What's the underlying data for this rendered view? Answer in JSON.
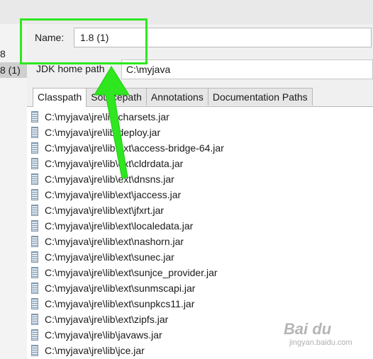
{
  "left": {
    "item1": "8",
    "item2": "8 (1)"
  },
  "form": {
    "name_label": "Name:",
    "name_value": "1.8 (1)",
    "jdk_label": "JDK home path",
    "jdk_value": "C:\\myjava"
  },
  "tabs": [
    {
      "label": "Classpath",
      "active": true
    },
    {
      "label": "Sourcepath"
    },
    {
      "label": "Annotations"
    },
    {
      "label": "Documentation Paths"
    }
  ],
  "classpath": [
    "C:\\myjava\\jre\\lib\\charsets.jar",
    "C:\\myjava\\jre\\lib\\deploy.jar",
    "C:\\myjava\\jre\\lib\\ext\\access-bridge-64.jar",
    "C:\\myjava\\jre\\lib\\ext\\cldrdata.jar",
    "C:\\myjava\\jre\\lib\\ext\\dnsns.jar",
    "C:\\myjava\\jre\\lib\\ext\\jaccess.jar",
    "C:\\myjava\\jre\\lib\\ext\\jfxrt.jar",
    "C:\\myjava\\jre\\lib\\ext\\localedata.jar",
    "C:\\myjava\\jre\\lib\\ext\\nashorn.jar",
    "C:\\myjava\\jre\\lib\\ext\\sunec.jar",
    "C:\\myjava\\jre\\lib\\ext\\sunjce_provider.jar",
    "C:\\myjava\\jre\\lib\\ext\\sunmscapi.jar",
    "C:\\myjava\\jre\\lib\\ext\\sunpkcs11.jar",
    "C:\\myjava\\jre\\lib\\ext\\zipfs.jar",
    "C:\\myjava\\jre\\lib\\javaws.jar",
    "C:\\myjava\\jre\\lib\\jce.jar"
  ],
  "watermark": {
    "main": "Bai du",
    "sub": "jingyan.baidu.com"
  },
  "colors": {
    "annotation": "#2ee71f"
  },
  "icons": {
    "jar": "jar-file-icon",
    "arrow": "annotation-arrow"
  }
}
